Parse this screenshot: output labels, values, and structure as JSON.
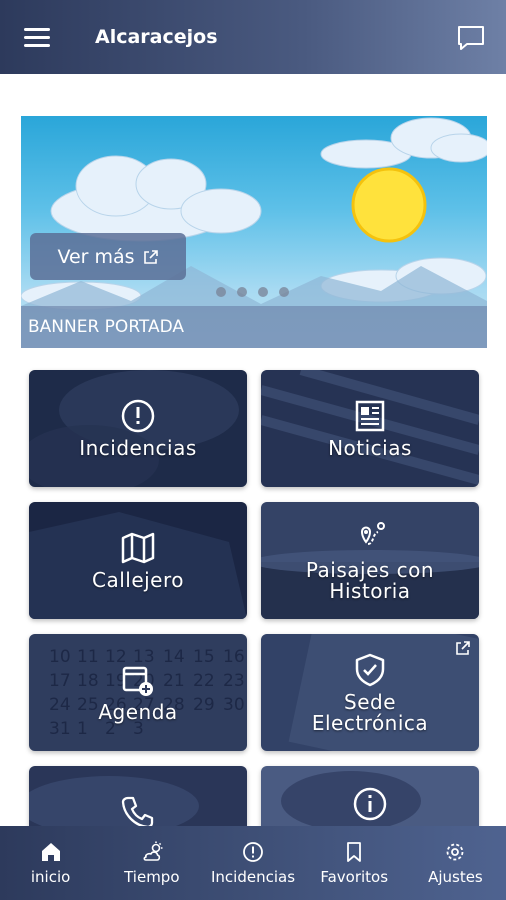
{
  "header": {
    "title": "Alcaracejos",
    "menu_icon": "hamburger-icon",
    "chat_icon": "chat-icon"
  },
  "banner": {
    "button_label": "Ver más",
    "caption": "BANNER PORTADA",
    "slide_count": 4,
    "active_slide": 1
  },
  "tiles": [
    {
      "label": "Incidencias",
      "icon": "alert-circle-icon"
    },
    {
      "label": "Noticias",
      "icon": "newspaper-icon"
    },
    {
      "label": "Callejero",
      "icon": "map-icon"
    },
    {
      "label_line1": "Paisajes con",
      "label_line2": "Historia",
      "icon": "route-pin-icon"
    },
    {
      "label": "Agenda",
      "icon": "calendar-add-icon"
    },
    {
      "label_line1": "Sede",
      "label_line2": "Electrónica",
      "icon": "shield-check-icon"
    },
    {
      "label": "",
      "icon": "phone-icon"
    },
    {
      "label": "",
      "icon": "info-icon"
    }
  ],
  "nav": [
    {
      "label": "inicio",
      "icon": "home-icon"
    },
    {
      "label": "Tiempo",
      "icon": "weather-icon"
    },
    {
      "label": "Incidencias",
      "icon": "alert-circle-icon"
    },
    {
      "label": "Favoritos",
      "icon": "bookmark-icon"
    },
    {
      "label": "Ajustes",
      "icon": "gear-icon"
    }
  ],
  "colors": {
    "header": "#3c4b70",
    "tile_overlay": "#1e2a48",
    "accent": "#2d3a5c"
  }
}
